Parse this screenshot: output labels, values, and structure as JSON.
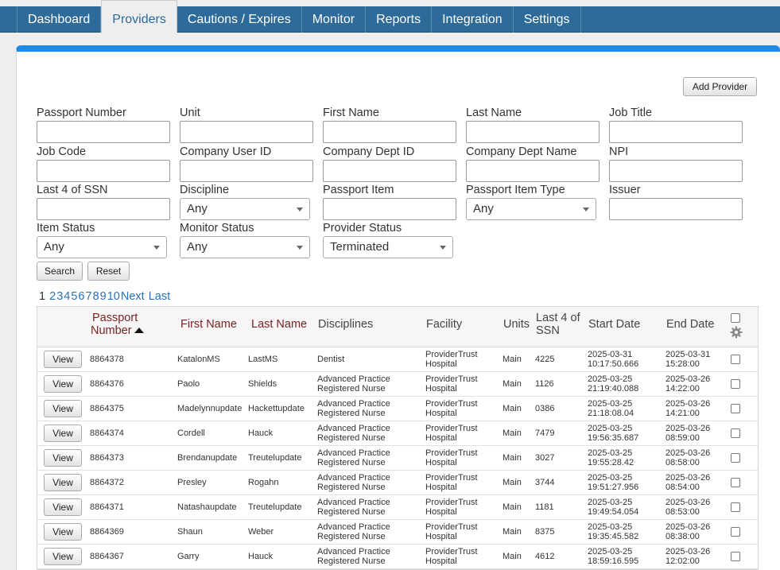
{
  "nav": {
    "tabs": [
      "Dashboard",
      "Providers",
      "Cautions / Expires",
      "Monitor",
      "Reports",
      "Integration",
      "Settings"
    ],
    "active": "Providers"
  },
  "buttons": {
    "add_provider": "Add Provider",
    "search": "Search",
    "reset": "Reset",
    "view": "View"
  },
  "filters": {
    "passport_number": {
      "label": "Passport Number",
      "value": ""
    },
    "unit": {
      "label": "Unit",
      "value": ""
    },
    "first_name": {
      "label": "First Name",
      "value": ""
    },
    "last_name": {
      "label": "Last Name",
      "value": ""
    },
    "job_title": {
      "label": "Job Title",
      "value": ""
    },
    "job_code": {
      "label": "Job Code",
      "value": ""
    },
    "company_user_id": {
      "label": "Company User ID",
      "value": ""
    },
    "company_dept_id": {
      "label": "Company Dept ID",
      "value": ""
    },
    "company_dept_name": {
      "label": "Company Dept Name",
      "value": ""
    },
    "npi": {
      "label": "NPI",
      "value": ""
    },
    "last4_ssn": {
      "label": "Last 4 of SSN",
      "value": ""
    },
    "discipline": {
      "label": "Discipline",
      "value": "Any"
    },
    "passport_item": {
      "label": "Passport Item",
      "value": ""
    },
    "passport_item_type": {
      "label": "Passport Item Type",
      "value": "Any"
    },
    "issuer": {
      "label": "Issuer",
      "value": ""
    },
    "item_status": {
      "label": "Item Status",
      "value": "Any"
    },
    "monitor_status": {
      "label": "Monitor Status",
      "value": "Any"
    },
    "provider_status": {
      "label": "Provider Status",
      "value": "Terminated"
    }
  },
  "pager": {
    "current": "1",
    "pages": [
      "2",
      "3",
      "4",
      "5",
      "6",
      "7",
      "8",
      "9",
      "10"
    ],
    "next": "Next",
    "last": "Last"
  },
  "table": {
    "headers": {
      "passport_l1": "Passport",
      "passport_l2": "Number",
      "first_name": "First Name",
      "last_name": "Last Name",
      "disciplines": "Disciplines",
      "facility": "Facility",
      "units": "Units",
      "ssn_l1": "Last 4 of",
      "ssn_l2": "SSN",
      "start_date": "Start Date",
      "end_date": "End Date"
    },
    "rows": [
      {
        "passport": "8864378",
        "first": "KatalonMS",
        "last": "LastMS",
        "disc1": "Dentist",
        "disc2": "",
        "fac1": "ProviderTrust",
        "fac2": "Hospital",
        "unit": "Main",
        "ssn": "4225",
        "start1": "2025-03-31",
        "start2": "10:17:50.666",
        "end1": "2025-03-31",
        "end2": "15:28:00"
      },
      {
        "passport": "8864376",
        "first": "Paolo",
        "last": "Shields",
        "disc1": "Advanced Practice",
        "disc2": "Registered Nurse",
        "fac1": "ProviderTrust",
        "fac2": "Hospital",
        "unit": "Main",
        "ssn": "1126",
        "start1": "2025-03-25",
        "start2": "21:19:40.088",
        "end1": "2025-03-26",
        "end2": "14:22:00"
      },
      {
        "passport": "8864375",
        "first": "Madelynnupdate",
        "last": "Hackettupdate",
        "disc1": "Advanced Practice",
        "disc2": "Registered Nurse",
        "fac1": "ProviderTrust",
        "fac2": "Hospital",
        "unit": "Main",
        "ssn": "0386",
        "start1": "2025-03-25",
        "start2": "21:18:08.04",
        "end1": "2025-03-26",
        "end2": "14:21:00"
      },
      {
        "passport": "8864374",
        "first": "Cordell",
        "last": "Hauck",
        "disc1": "Advanced Practice",
        "disc2": "Registered Nurse",
        "fac1": "ProviderTrust",
        "fac2": "Hospital",
        "unit": "Main",
        "ssn": "7479",
        "start1": "2025-03-25",
        "start2": "19:56:35.687",
        "end1": "2025-03-26",
        "end2": "08:59:00"
      },
      {
        "passport": "8864373",
        "first": "Brendanupdate",
        "last": "Treutelupdate",
        "disc1": "Advanced Practice",
        "disc2": "Registered Nurse",
        "fac1": "ProviderTrust",
        "fac2": "Hospital",
        "unit": "Main",
        "ssn": "3027",
        "start1": "2025-03-25",
        "start2": "19:55:28.42",
        "end1": "2025-03-26",
        "end2": "08:58:00"
      },
      {
        "passport": "8864372",
        "first": "Presley",
        "last": "Rogahn",
        "disc1": "Advanced Practice",
        "disc2": "Registered Nurse",
        "fac1": "ProviderTrust",
        "fac2": "Hospital",
        "unit": "Main",
        "ssn": "3744",
        "start1": "2025-03-25",
        "start2": "19:51:27.956",
        "end1": "2025-03-26",
        "end2": "08:54:00"
      },
      {
        "passport": "8864371",
        "first": "Natashaupdate",
        "last": "Treutelupdate",
        "disc1": "Advanced Practice",
        "disc2": "Registered Nurse",
        "fac1": "ProviderTrust",
        "fac2": "Hospital",
        "unit": "Main",
        "ssn": "1181",
        "start1": "2025-03-25",
        "start2": "19:49:54.054",
        "end1": "2025-03-26",
        "end2": "08:53:00"
      },
      {
        "passport": "8864369",
        "first": "Shaun",
        "last": "Weber",
        "disc1": "Advanced Practice",
        "disc2": "Registered Nurse",
        "fac1": "ProviderTrust",
        "fac2": "Hospital",
        "unit": "Main",
        "ssn": "8375",
        "start1": "2025-03-25",
        "start2": "19:35:45.582",
        "end1": "2025-03-26",
        "end2": "08:38:00"
      },
      {
        "passport": "8864367",
        "first": "Garry",
        "last": "Hauck",
        "disc1": "Advanced Practice",
        "disc2": "Registered Nurse",
        "fac1": "ProviderTrust",
        "fac2": "Hospital",
        "unit": "Main",
        "ssn": "4612",
        "start1": "2025-03-25",
        "start2": "18:59:16.595",
        "end1": "2025-03-26",
        "end2": "12:02:00"
      }
    ]
  }
}
